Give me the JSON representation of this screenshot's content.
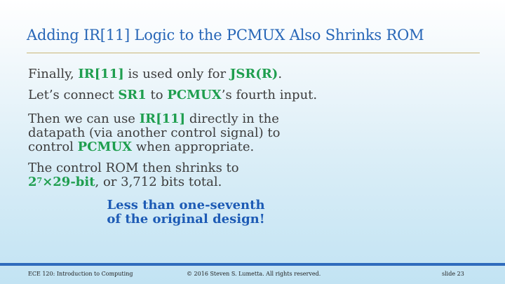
{
  "slide": {
    "title": "Adding IR[11] Logic to the PCMUX Also Shrinks ROM",
    "p1": {
      "t1": "Finally, ",
      "b1": "IR[11]",
      "t2": " is used only for ",
      "b2": "JSR(R)",
      "t3": "."
    },
    "p2": {
      "t1": "Let’s connect ",
      "b1": "SR1",
      "t2": " to ",
      "b2": "PCMUX",
      "t3": "’s fourth input."
    },
    "p3": {
      "t1": "Then we can use ",
      "b1": "IR[11]",
      "t2": " directly in the",
      "line2": "datapath (via another control signal) to",
      "t3": "control ",
      "b2": "PCMUX",
      "t4": " when appropriate."
    },
    "p4": {
      "line1": "The control ROM then shrinks to",
      "b1_base": "2",
      "b1_exp": "7",
      "b1_rest": "×29-bit",
      "t1": ", or 3,712 bits total."
    },
    "callout": {
      "line1": "Less than one-seventh",
      "line2": "of the original design!"
    }
  },
  "footer": {
    "course": "ECE 120: Introduction to Computing",
    "copyright": "© 2016 Steven S. Lumetta.  All rights reserved.",
    "slide_num": "slide 23"
  },
  "colors": {
    "title": "#2766b7",
    "highlight": "#1e9e4e",
    "callout": "#1d5bb5",
    "footer_bar": "#2f6bbd",
    "rule": "#c9b676"
  }
}
